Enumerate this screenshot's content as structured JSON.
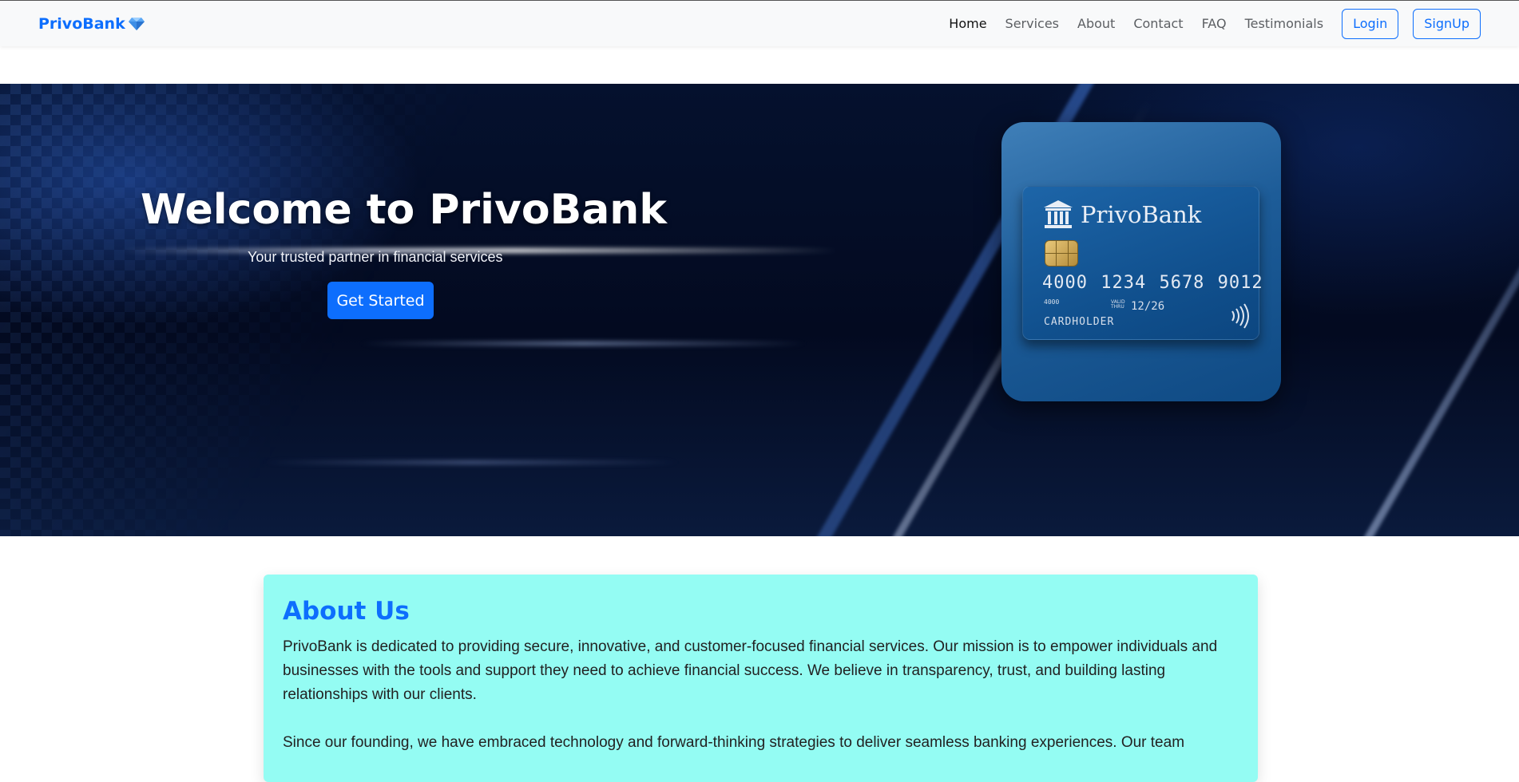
{
  "navbar": {
    "brand": "PrivoBank",
    "brand_icon": "gem-icon",
    "links": [
      "Home",
      "Services",
      "About",
      "Contact",
      "FAQ",
      "Testimonials"
    ],
    "active_link": "Home",
    "login_label": "Login",
    "signup_label": "SignUp"
  },
  "hero": {
    "title": "Welcome to PrivoBank",
    "subtitle": "Your trusted partner in financial services",
    "cta_label": "Get Started",
    "card": {
      "bank_name": "PrivoBank",
      "bank_icon": "bank-building-icon",
      "number": "4000 1234 5678 9012",
      "small_number": "4000",
      "valid_thru_label": "VALID THRU",
      "expiry": "12/26",
      "holder": "CARDHOLDER"
    }
  },
  "about": {
    "heading": "About Us",
    "paragraph1": "PrivoBank is dedicated to providing secure, innovative, and customer-focused financial services. Our mission is to empower individuals and businesses with the tools and support they need to achieve financial success. We believe in transparency, trust, and building lasting relationships with our clients.",
    "paragraph2": "Since our founding, we have embraced technology and forward-thinking strategies to deliver seamless banking experiences. Our team"
  },
  "colors": {
    "primary": "#0d6efd",
    "about_bg": "#94fcf3",
    "navbar_bg": "#f8f9fa"
  }
}
